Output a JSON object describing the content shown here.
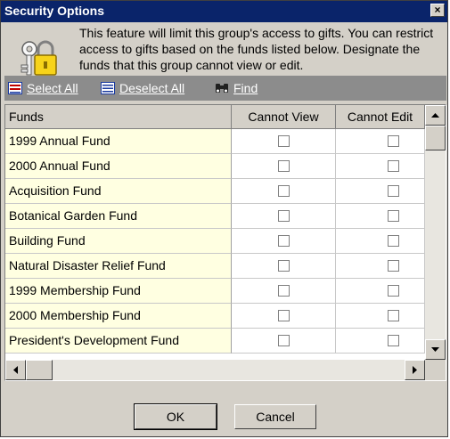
{
  "window": {
    "title": "Security Options",
    "close_symbol": "×"
  },
  "message": "This feature will limit this group's access to gifts.  You can restrict access to gifts based on the funds listed below. Designate the funds that this group cannot view or edit.",
  "toolbar": {
    "select_all": "Select All",
    "deselect_all": "Deselect All",
    "find": "Find"
  },
  "table": {
    "headers": [
      "Funds",
      "Cannot View",
      "Cannot Edit"
    ],
    "rows": [
      {
        "fund": "1999 Annual Fund",
        "cannot_view": false,
        "cannot_edit": false
      },
      {
        "fund": "2000 Annual Fund",
        "cannot_view": false,
        "cannot_edit": false
      },
      {
        "fund": "Acquisition Fund",
        "cannot_view": false,
        "cannot_edit": false
      },
      {
        "fund": "Botanical Garden Fund",
        "cannot_view": false,
        "cannot_edit": false
      },
      {
        "fund": "Building Fund",
        "cannot_view": false,
        "cannot_edit": false
      },
      {
        "fund": "Natural Disaster Relief Fund",
        "cannot_view": false,
        "cannot_edit": false
      },
      {
        "fund": "1999 Membership Fund",
        "cannot_view": false,
        "cannot_edit": false
      },
      {
        "fund": "2000 Membership Fund",
        "cannot_view": false,
        "cannot_edit": false
      },
      {
        "fund": "President's Development Fund",
        "cannot_view": false,
        "cannot_edit": false
      }
    ]
  },
  "buttons": {
    "ok": "OK",
    "cancel": "Cancel"
  },
  "colors": {
    "titlebar": "#0a246a",
    "fund_cell": "#ffffe1",
    "toolbar": "#8c8c8c",
    "face": "#d4d0c8"
  },
  "icons": {
    "dialog": "lock-key-icon",
    "select_all": "select-all-icon",
    "deselect_all": "deselect-all-icon",
    "find": "binoculars-icon"
  }
}
